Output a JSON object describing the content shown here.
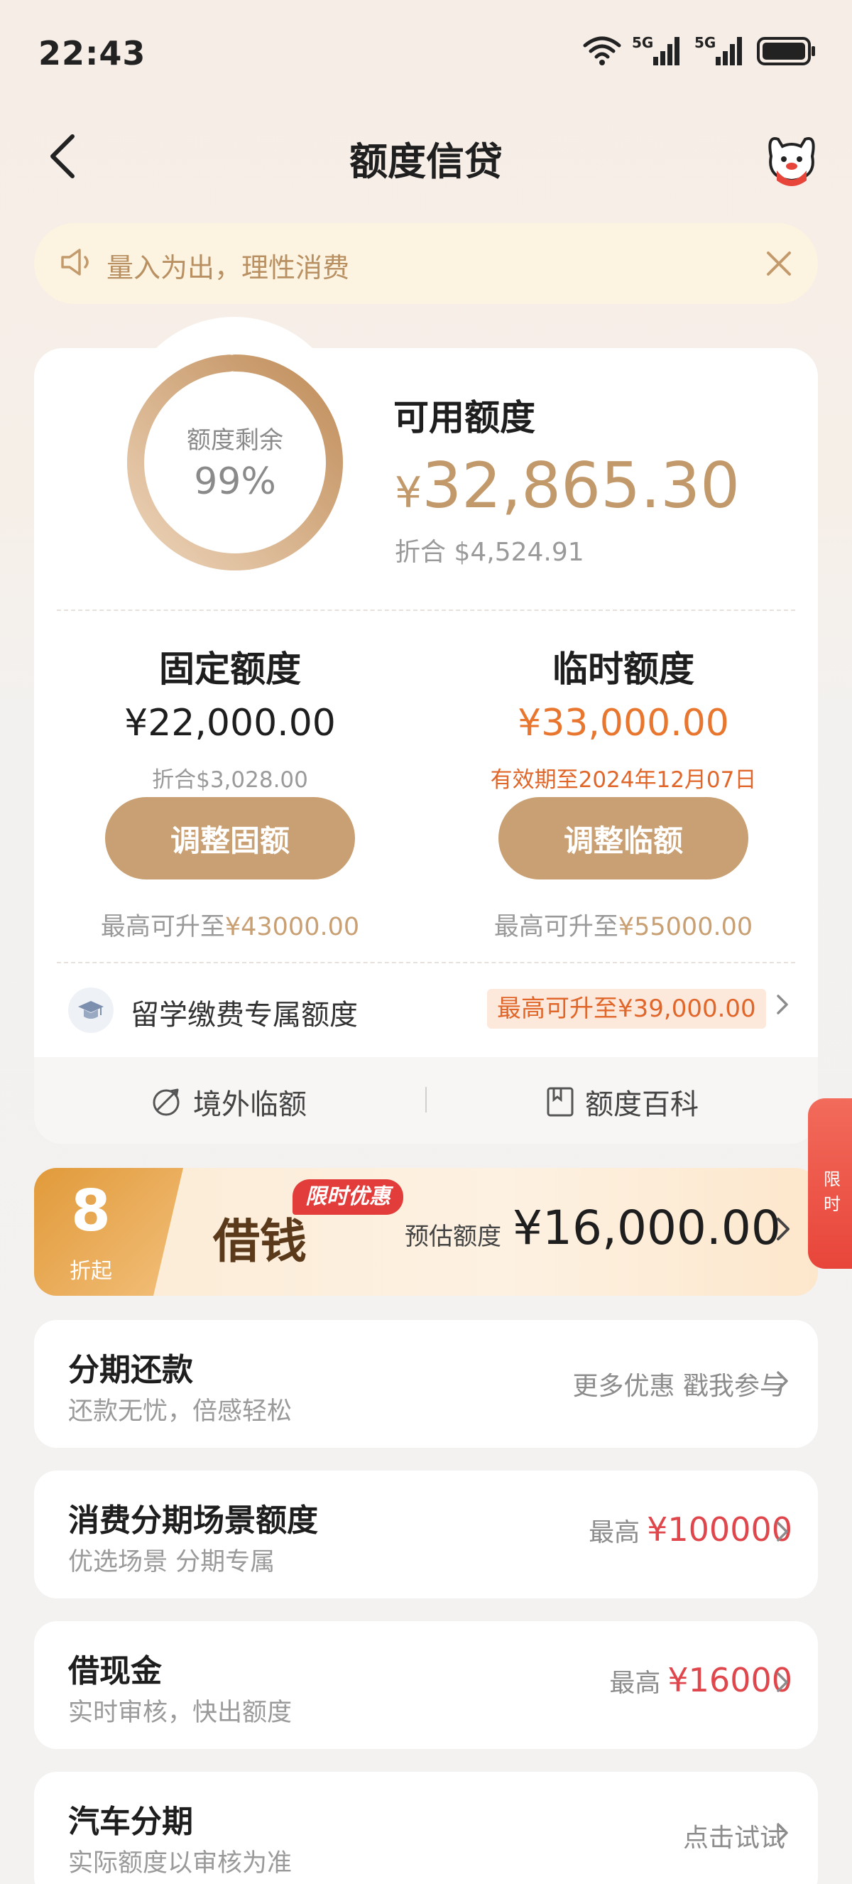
{
  "status_bar": {
    "time": "22:43",
    "network_1": "5G",
    "network_2": "5G",
    "icons": [
      "wifi-icon",
      "signal-icon",
      "signal-icon",
      "battery-icon"
    ]
  },
  "header": {
    "title": "额度信贷",
    "back_icon": "chevron-left-icon",
    "mascot_icon": "mascot-avatar-icon"
  },
  "notice": {
    "text": "量入为出，理性消费",
    "icon": "speaker-icon",
    "close_icon": "close-icon"
  },
  "credit": {
    "ring_label": "额度剩余",
    "ring_value": "99%",
    "ring_fraction": 0.99,
    "available_label": "可用额度",
    "available_currency": "¥",
    "available_amount": "32,865.30",
    "available_converted": "折合 $4,524.91"
  },
  "fixed": {
    "title": "固定额度",
    "amount": "¥22,000.00",
    "sub": "折合$3,028.00",
    "button": "调整固额",
    "max_prefix": "最高可升至",
    "max_value": "¥43000.00"
  },
  "temporary": {
    "title": "临时额度",
    "amount": "¥33,000.00",
    "sub": "有效期至2024年12月07日",
    "button": "调整临额",
    "max_prefix": "最高可升至",
    "max_value": "¥55000.00"
  },
  "study": {
    "icon": "graduation-cap-icon",
    "label": "留学缴费专属额度",
    "badge": "最高可升至¥39,000.00"
  },
  "footer_links": {
    "overseas": "境外临额",
    "overseas_icon": "plane-globe-icon",
    "wiki": "额度百科",
    "wiki_icon": "book-icon"
  },
  "promo": {
    "discount_number": "8",
    "discount_label": "折起",
    "title": "借钱",
    "tag": "限时优惠",
    "estimate_label": "预估额度",
    "estimate_amount": "¥16,000.00"
  },
  "side_tab": {
    "text": "限时"
  },
  "list": [
    {
      "title": "分期还款",
      "subtitle": "还款无忧，倍感轻松",
      "right_label": "更多优惠 戳我参与",
      "right_value": ""
    },
    {
      "title": "消费分期场景额度",
      "subtitle": "优选场景 分期专属",
      "right_label": "最高",
      "right_value": "¥100000"
    },
    {
      "title": "借现金",
      "subtitle": "实时审核，快出额度",
      "right_label": "最高",
      "right_value": "¥16000"
    },
    {
      "title": "汽车分期",
      "subtitle": "实际额度以审核为准",
      "right_label": "点击试试",
      "right_value": ""
    }
  ],
  "colors": {
    "accent_gold": "#c9a073",
    "amount_gold": "#c2996a",
    "orange": "#e0662a",
    "red": "#e0474c",
    "notice_bg": "#fdf3e1"
  }
}
